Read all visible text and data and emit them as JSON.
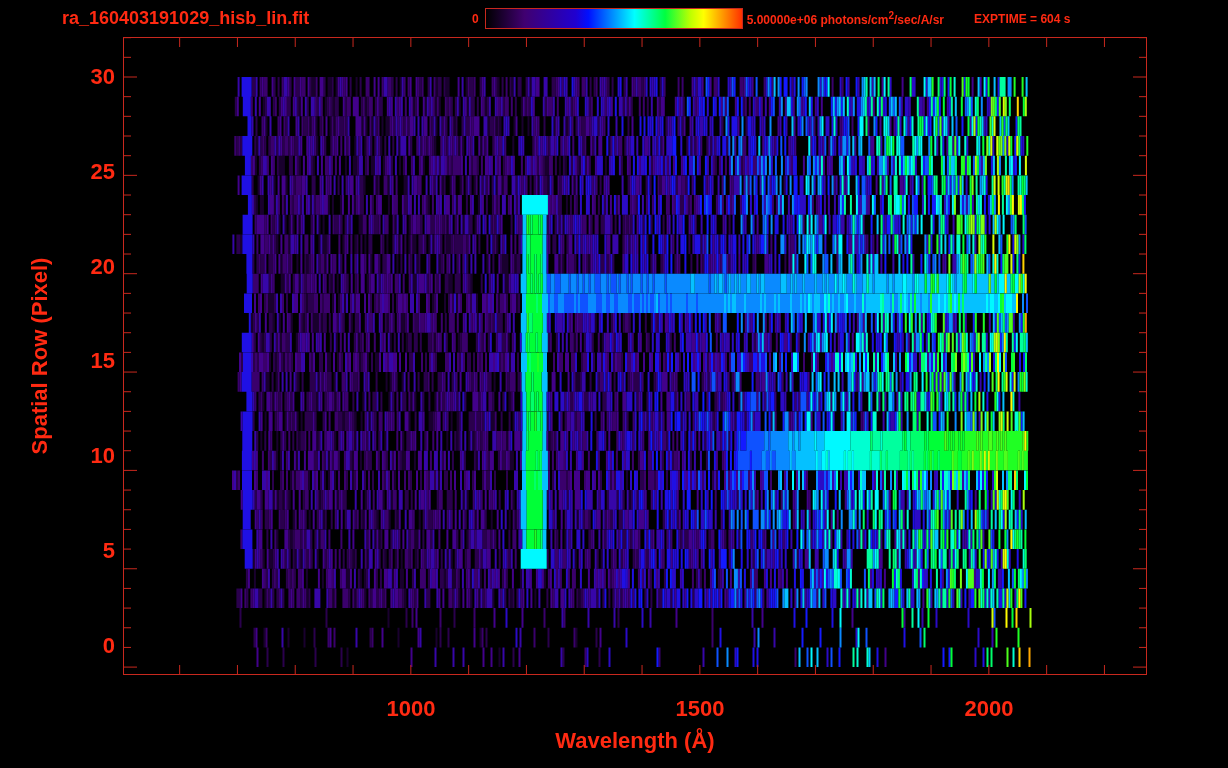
{
  "header": {
    "filename": "ra_160403191029_hisb_lin.fit",
    "colorbar": {
      "min_label": "0",
      "max_label": "5.00000e+06 photons/cm$^{2}$/sec/A/sr"
    },
    "exposure": "EXPTIME = 604 s"
  },
  "plot": {
    "ylabel": "Spatial Row (Pixel)",
    "xlabel": "Wavelength (Å)",
    "yticks": [
      "30",
      "25",
      "20",
      "15",
      "10",
      "5",
      "0"
    ],
    "xticks": [
      "1000",
      "1500",
      "2000"
    ]
  }
}
